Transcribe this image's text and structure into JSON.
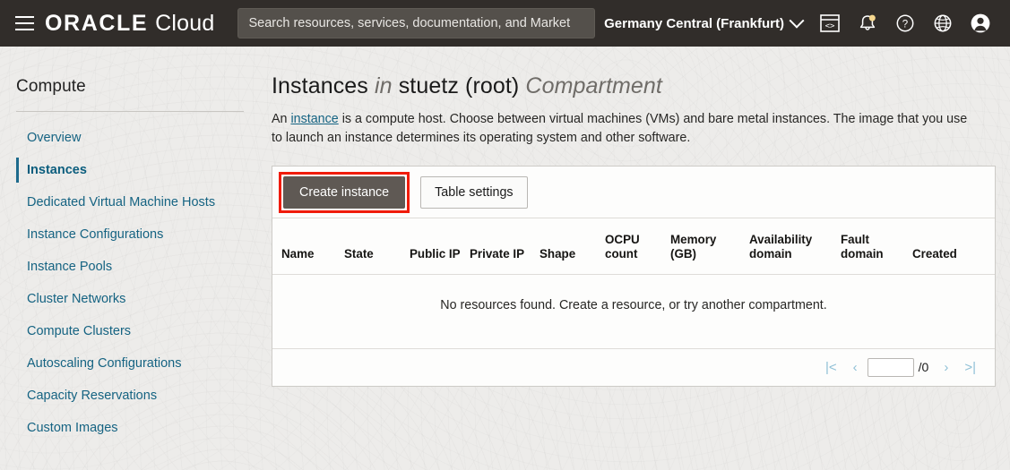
{
  "header": {
    "menu_icon": "hamburger-menu-icon",
    "brand_oracle": "ORACLE",
    "brand_cloud": "Cloud",
    "search_placeholder": "Search resources, services, documentation, and Market",
    "search_value": "",
    "region": "Germany Central (Frankfurt)",
    "icons": [
      {
        "name": "cloud-shell-icon",
        "title": "Cloud Shell"
      },
      {
        "name": "notifications-bell-icon",
        "title": "Notifications",
        "badge_color": "#f5d78e"
      },
      {
        "name": "help-question-icon",
        "title": "Help"
      },
      {
        "name": "language-globe-icon",
        "title": "Language"
      },
      {
        "name": "user-avatar-icon",
        "title": "Profile"
      }
    ],
    "colors": {
      "bar": "#312d2a",
      "search_bg": "#54504b"
    }
  },
  "sidebar": {
    "title": "Compute",
    "items": [
      {
        "label": "Overview",
        "active": false
      },
      {
        "label": "Instances",
        "active": true
      },
      {
        "label": "Dedicated Virtual Machine Hosts",
        "active": false
      },
      {
        "label": "Instance Configurations",
        "active": false
      },
      {
        "label": "Instance Pools",
        "active": false
      },
      {
        "label": "Cluster Networks",
        "active": false
      },
      {
        "label": "Compute Clusters",
        "active": false
      },
      {
        "label": "Autoscaling Configurations",
        "active": false
      },
      {
        "label": "Capacity Reservations",
        "active": false
      },
      {
        "label": "Custom Images",
        "active": false
      }
    ],
    "link_color": "#156382",
    "active_color": "#0b5d7d"
  },
  "main": {
    "title": {
      "part1": "Instances",
      "part2": "in",
      "part3": "stuetz (root)",
      "part4": "Compartment"
    },
    "description": {
      "before_link": "An ",
      "link": "instance",
      "after_link": " is a compute host. Choose between virtual machines (VMs) and bare metal instances. The image that you use to launch an instance determines its operating system and other software."
    },
    "toolbar": {
      "create_label": "Create instance",
      "table_settings_label": "Table settings",
      "highlight_color": "#f01c0a"
    },
    "table": {
      "columns": [
        "Name",
        "State",
        "Public IP",
        "Private IP",
        "Shape",
        "OCPU count",
        "Memory (GB)",
        "Availability domain",
        "Fault domain",
        "Created"
      ],
      "rows": [],
      "empty_message": "No resources found. Create a resource, or try another compartment."
    },
    "pagination": {
      "first_label": "|<",
      "prev_label": "‹",
      "page_value": "",
      "total_label": "/0",
      "next_label": "›",
      "last_label": ">|"
    }
  }
}
